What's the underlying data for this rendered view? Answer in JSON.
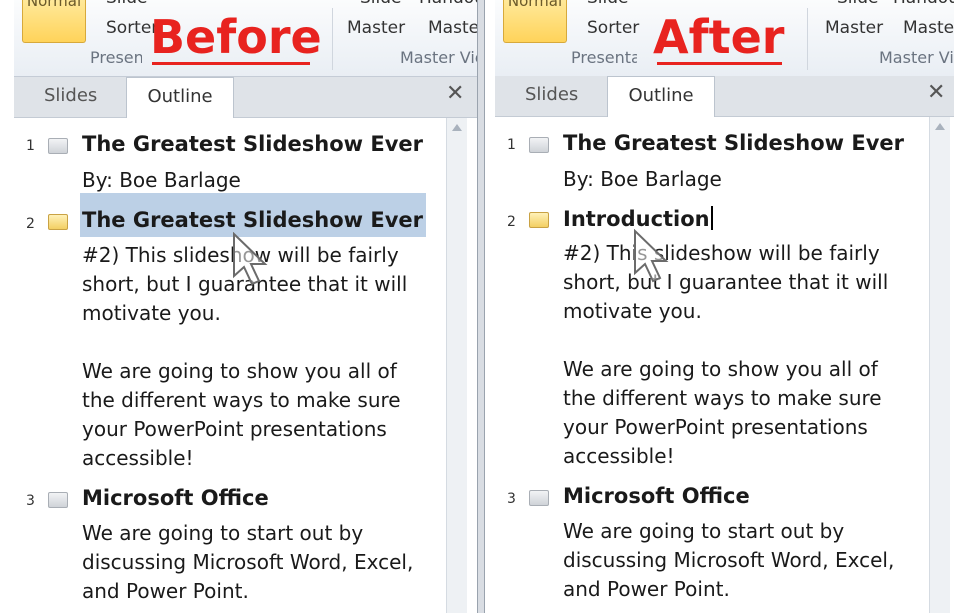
{
  "before": {
    "ribbon": {
      "normal_btn": "Normal",
      "sorter_line1": "Slide",
      "sorter_line2": "Sorter",
      "presentation_group": "Presentation Views",
      "slide_master_line1": "Slide",
      "slide_master_line2": "Master",
      "handout_line1": "Handout",
      "handout_line2": "Master",
      "master_group": "Master Views",
      "label": "Before"
    },
    "tabs": {
      "slides": "Slides",
      "outline": "Outline",
      "close": "✕"
    },
    "outline": {
      "s1_num": "1",
      "s1_title": "The Greatest Slideshow Ever",
      "s1_body": "By: Boe Barlage",
      "s2_num": "2",
      "s2_title": "The Greatest Slideshow Ever",
      "s2_body": "#2) This slideshow will be fairly\nshort, but I guarantee that it will\nmotivate you.\n\nWe are going to show you all of\nthe different ways to make sure\nyour PowerPoint presentations\naccessible!",
      "s3_num": "3",
      "s3_title": "Microsoft Office",
      "s3_body": "We are going to start out by\ndiscussing Microsoft Word, Excel,\nand Power Point."
    }
  },
  "after": {
    "ribbon": {
      "normal_btn": "Normal",
      "sorter_line1": "Slide",
      "sorter_line2": "Sorter",
      "presentation_group": "Presentation Views",
      "slide_master_line1": "Slide",
      "slide_master_line2": "Master",
      "handout_line1": "Handout",
      "handout_line2": "Master",
      "master_group": "Master Views",
      "label": "After"
    },
    "tabs": {
      "slides": "Slides",
      "outline": "Outline",
      "close": "✕"
    },
    "outline": {
      "s1_num": "1",
      "s1_title": "The Greatest Slideshow Ever",
      "s1_body": "By: Boe Barlage",
      "s2_num": "2",
      "s2_title": "Introduction",
      "s2_body": "#2) This slideshow will be fairly\nshort, but I guarantee that it will\nmotivate you.\n\nWe are going to show you all of\nthe different ways to make sure\nyour PowerPoint presentations\naccessible!",
      "s3_num": "3",
      "s3_title": "Microsoft Office",
      "s3_body": "We are going to start out by\ndiscussing Microsoft Word, Excel,\nand Power Point."
    }
  }
}
